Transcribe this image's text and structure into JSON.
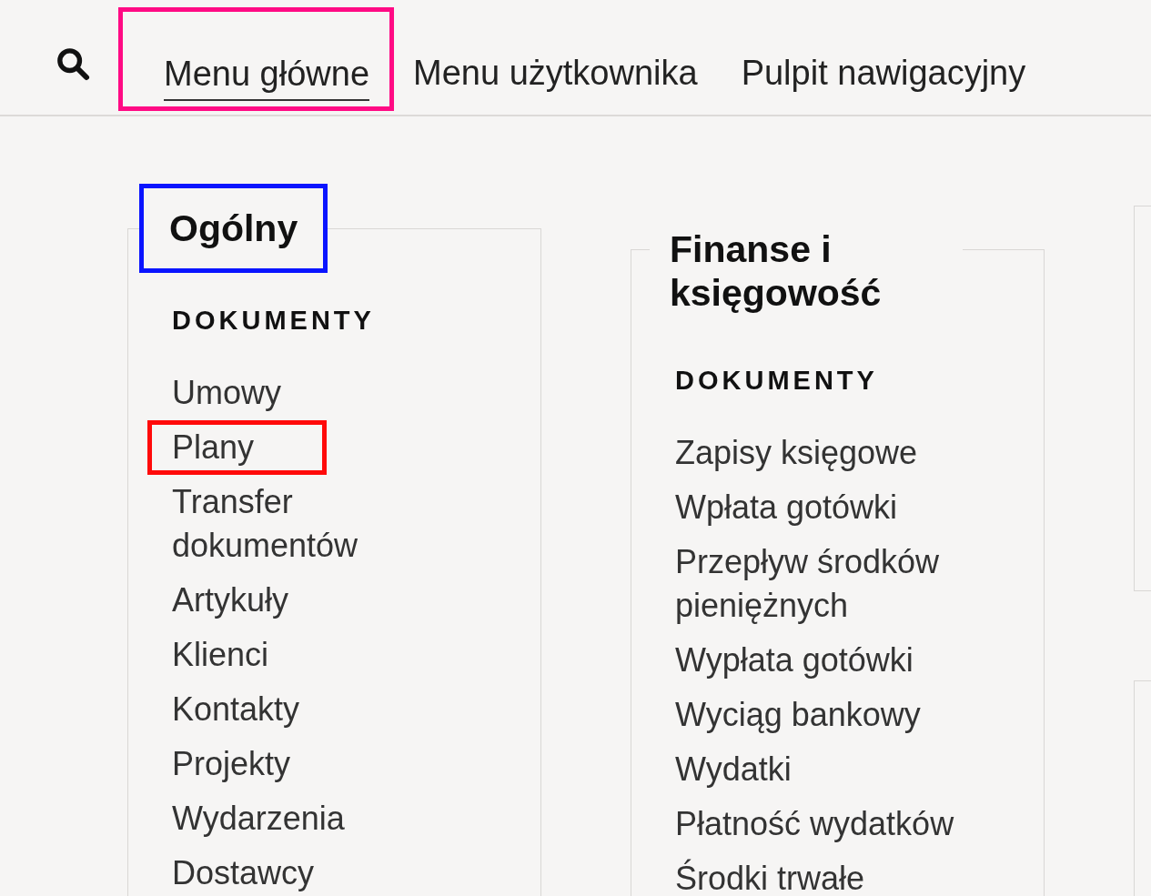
{
  "nav": {
    "tabs": [
      {
        "label": "Menu główne",
        "selected": true,
        "highlight": {
          "color": "#ff0a84"
        }
      },
      {
        "label": "Menu użytkownika",
        "selected": false
      },
      {
        "label": "Pulpit nawigacyjny",
        "selected": false
      }
    ]
  },
  "columns": [
    {
      "title": "Ogólny",
      "highlight": {
        "color": "#0a14ff"
      },
      "sections": [
        {
          "heading": "DOKUMENTY",
          "items": [
            {
              "label": "Umowy"
            },
            {
              "label": "Plany",
              "highlight": {
                "color": "#ff0a0a"
              }
            },
            {
              "label": "Transfer dokumentów"
            },
            {
              "label": "Artykuły"
            },
            {
              "label": "Klienci"
            },
            {
              "label": "Kontakty"
            },
            {
              "label": "Projekty"
            },
            {
              "label": "Wydarzenia"
            },
            {
              "label": "Dostawcy"
            }
          ]
        }
      ]
    },
    {
      "title": "Finanse i księgowość",
      "sections": [
        {
          "heading": "DOKUMENTY",
          "items": [
            {
              "label": "Zapisy księgowe"
            },
            {
              "label": "Wpłata gotówki"
            },
            {
              "label": "Przepływ środków pieniężnych"
            },
            {
              "label": "Wypłata gotówki"
            },
            {
              "label": "Wyciąg bankowy"
            },
            {
              "label": "Wydatki"
            },
            {
              "label": "Płatność wydatków"
            },
            {
              "label": "Środki trwałe"
            }
          ]
        }
      ]
    }
  ]
}
